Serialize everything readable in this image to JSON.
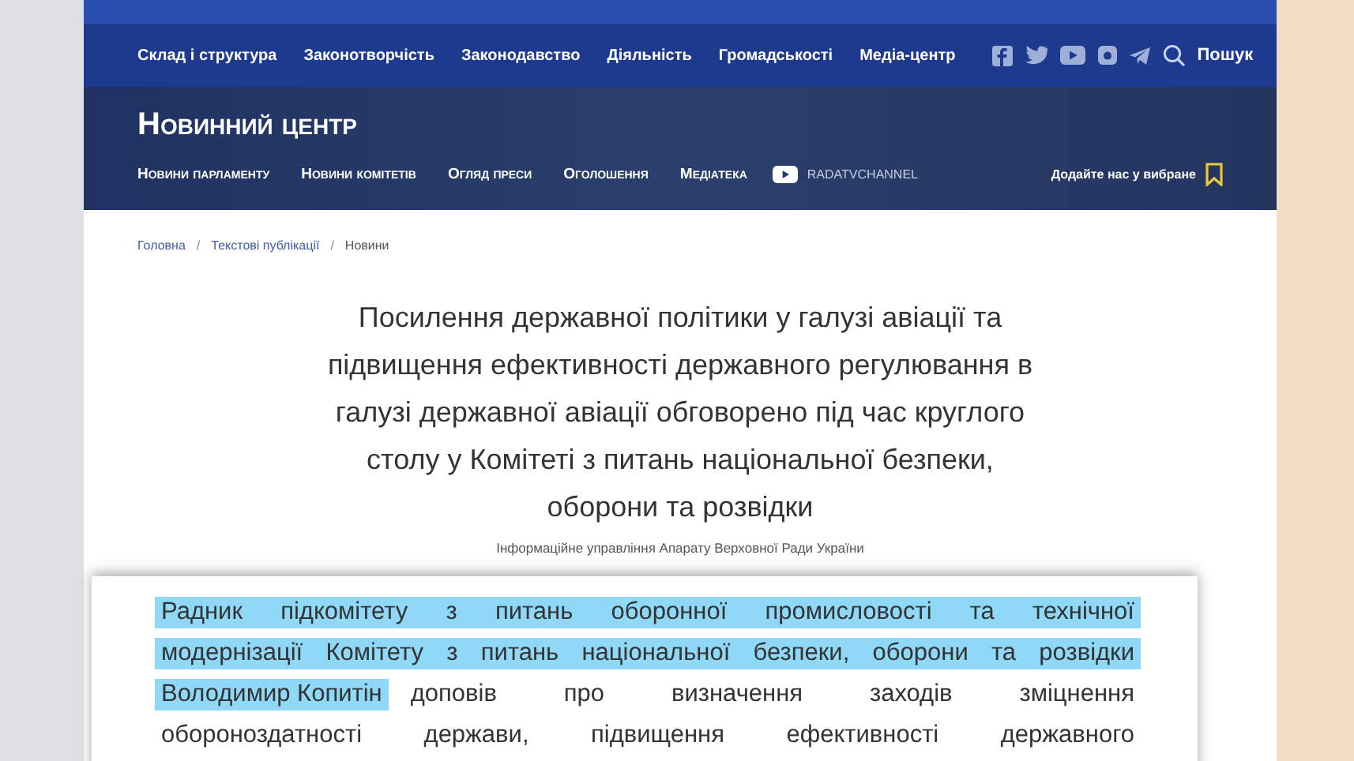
{
  "nav": {
    "items": [
      "Склад і структура",
      "Законотворчість",
      "Законодавство",
      "Діяльність",
      "Громадськості",
      "Медіа-центр"
    ],
    "search_label": "Пошук"
  },
  "header": {
    "title": "Новинний центр",
    "subnav": [
      "Новини парламенту",
      "Новини комітетів",
      "Огляд преси",
      "Оголошення",
      "Медіатека"
    ],
    "channel": "RADATVCHANNEL",
    "favorites": "Додайте нас у вибране"
  },
  "breadcrumb": [
    "Головна",
    "Текстові публікації",
    "Новини"
  ],
  "breadcrumb_separators": [
    "/",
    "/"
  ],
  "article": {
    "title": "Посилення державної політики у галузі авіації та підвищення ефективності державного регулювання в галузі державної авіації обговорено під час круглого столу у Комітеті з питань національної безпеки, оборони та розвідки",
    "source": "Інформаційне управління Апарату Верховної Ради України"
  },
  "excerpt": {
    "lines": [
      {
        "highlighted": "Радник підкомітету з питань оборонної промисловості та технічної"
      },
      {
        "highlighted": "модернізації Комітету з питань національної безпеки, оборони та розвідки"
      },
      {
        "highlighted": "Володимир Копитін",
        "text": "доповів про визначення заходів зміцнення"
      },
      {
        "text": "обороноздатності держави, підвищення ефективності державного"
      }
    ]
  }
}
